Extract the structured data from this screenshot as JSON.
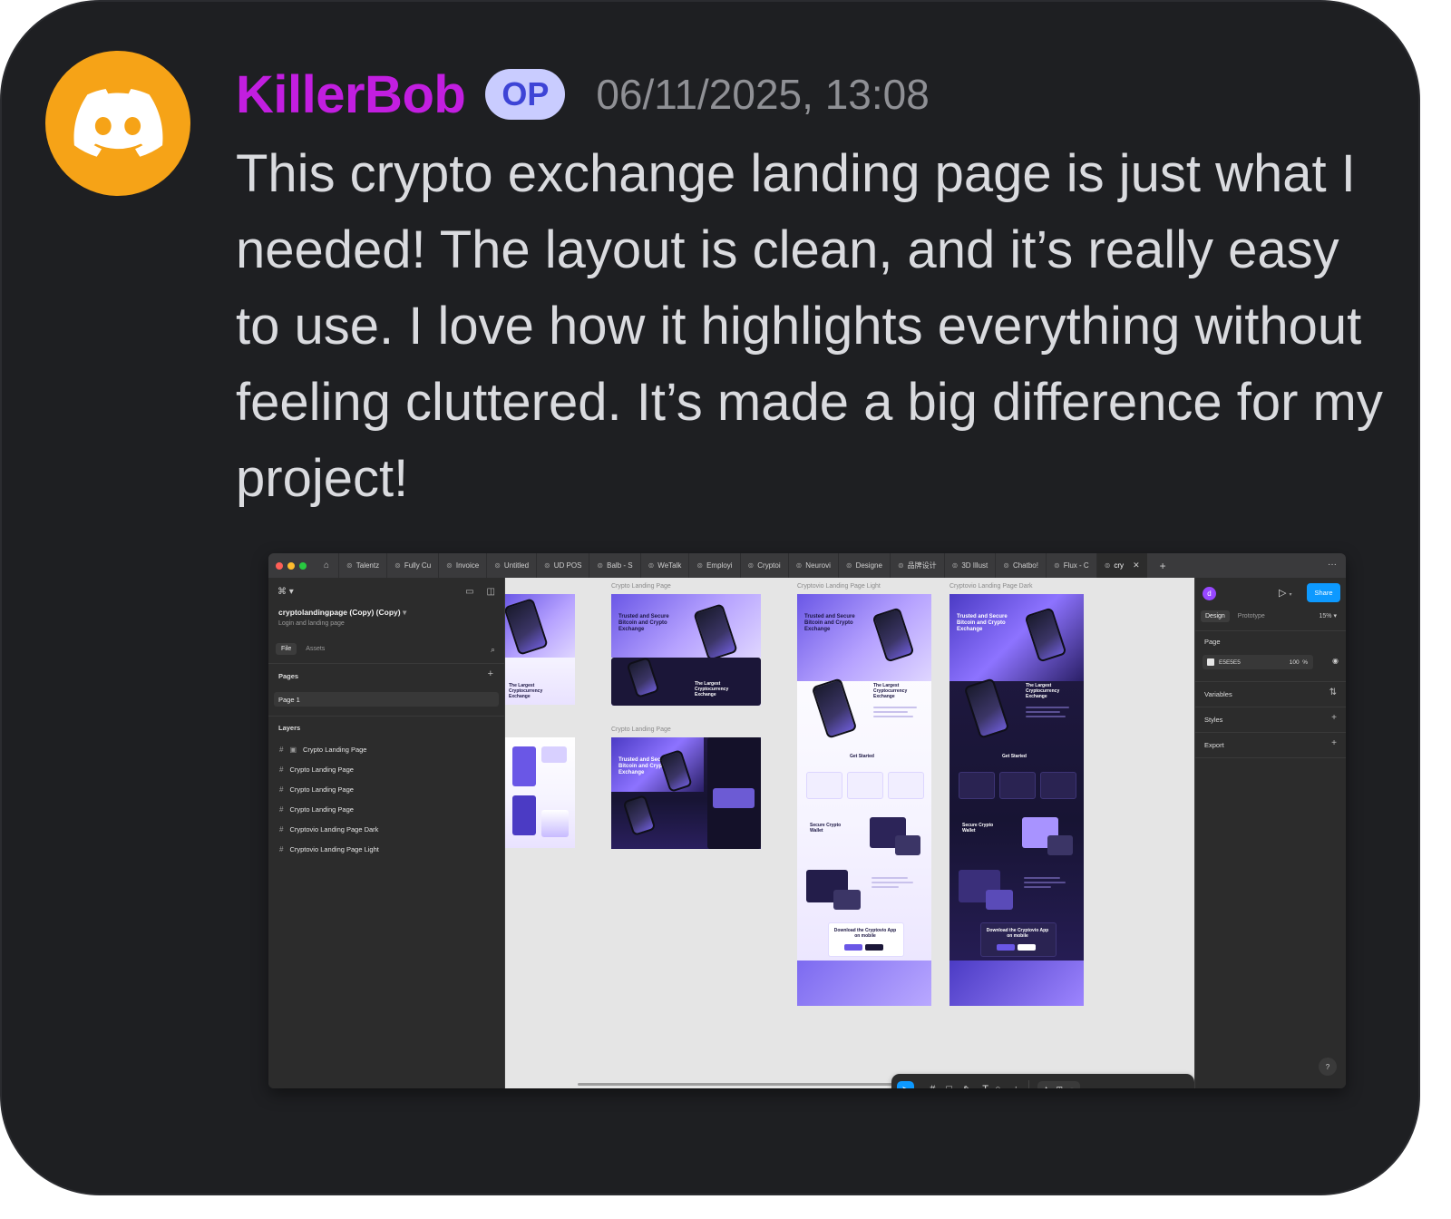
{
  "post": {
    "username": "KillerBob",
    "badge": "OP",
    "timestamp": "06/11/2025, 13:08",
    "message": "This crypto exchange landing page is just what I needed! The layout is clean, and it’s really easy to use. I love how it highlights everything without feeling cluttered. It’s made a big difference for my project!",
    "colors": {
      "username": "#c21ee0",
      "avatar_bg": "#f6a317",
      "background": "#1e1f22"
    },
    "avatar_icon": "discord-logo-icon"
  },
  "screenshot": {
    "tabs": [
      "Talentz",
      "Fully Cu",
      "Invoice",
      "Untitled",
      "UD POS",
      "Balb - S",
      "WeTalk",
      "Employi",
      "Cryptoi",
      "Neurovi",
      "Designe",
      "品牌设计",
      "3D Illust",
      "Chatbo!",
      "Flux - C",
      "cry"
    ],
    "active_tab_index": 15,
    "left_panel": {
      "file_name": "cryptolandingpage (Copy) (Copy)",
      "file_desc": "Login and landing page",
      "tab_file": "File",
      "tab_assets": "Assets",
      "pages_title": "Pages",
      "page_item": "Page 1",
      "layers_title": "Layers",
      "layers": [
        "Crypto Landing Page",
        "Crypto Landing Page",
        "Crypto Landing Page",
        "Crypto Landing Page",
        "Cryptovio Landing Page Dark",
        "Cryptovio Landing Page Light"
      ]
    },
    "canvas": {
      "label_1": "Crypto Landing Page",
      "label_2": "Crypto Landing Page",
      "label_light": "Cryptovio Landing Page Light",
      "label_dark": "Cryptovio Landing Page Dark",
      "hero_text": "Trusted and Secure Bitcoin and Crypto Exchange",
      "sub_text": "The Largest Cryptocurrency Exchange",
      "get_started": "Get Started",
      "wallet_text": "Secure Crypto Wallet",
      "download_text": "Download the Cryptovio App on mobile"
    },
    "right_panel": {
      "avatar_letter": "d",
      "share_label": "Share",
      "tab_design": "Design",
      "tab_prototype": "Prototype",
      "zoom": "15%",
      "page_section": "Page",
      "page_color": "E5E5E5",
      "page_opacity": "100",
      "page_opacity_unit": "%",
      "variables": "Variables",
      "styles": "Styles",
      "export": "Export",
      "help": "?"
    }
  }
}
